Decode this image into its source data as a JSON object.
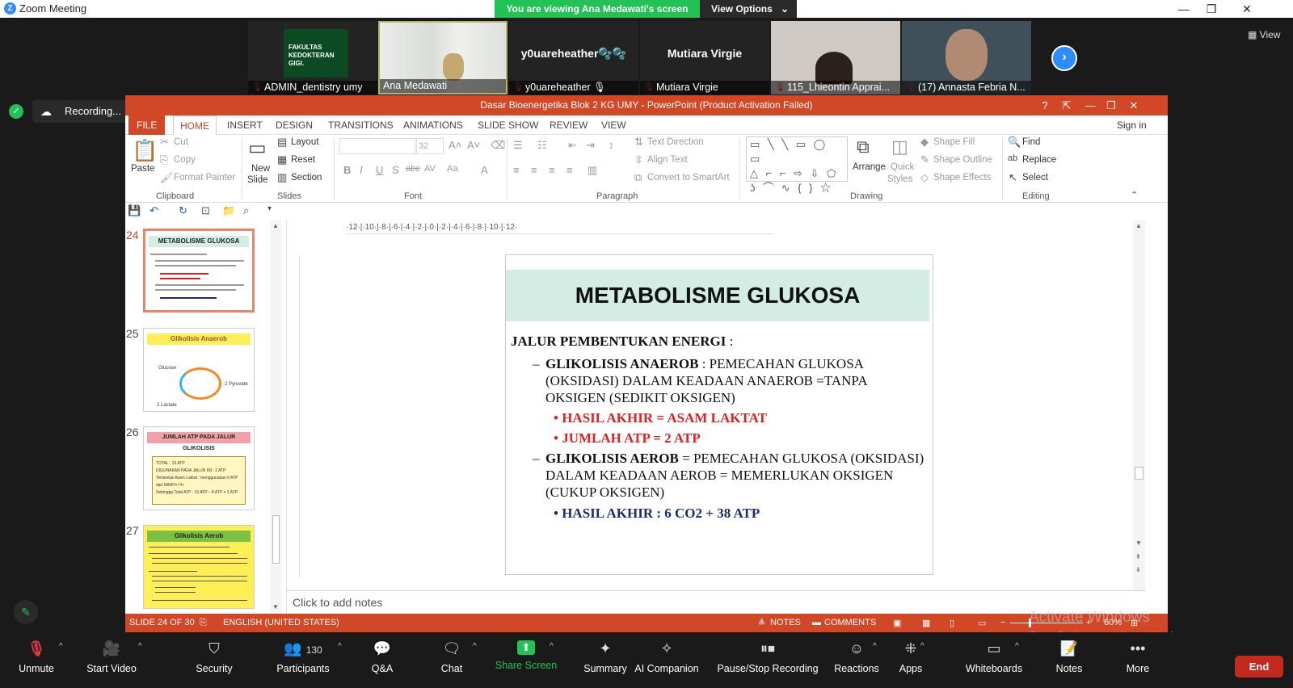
{
  "zoom": {
    "window_title": "Zoom Meeting",
    "viewing_banner": "You are viewing Ana Medawati's screen",
    "view_options": "View Options",
    "view_button": "View",
    "recording_label": "Recording...",
    "participants_strip": [
      {
        "name": "ADMIN_dentistry umy",
        "logo_text": "FAKULTAS KEDOKTERAN GIGI."
      },
      {
        "name": "Ana Medawati"
      },
      {
        "name": "y0uareheather 🎙",
        "display": "y0uareheather🫧🫧"
      },
      {
        "name": "Mutiara Virgie",
        "display": "Mutiara Virgie"
      },
      {
        "name": "115_Lhieontin Apprai..."
      },
      {
        "name": "(17) Annasta Febria N..."
      }
    ],
    "toolbar": {
      "unmute": "Unmute",
      "start_video": "Start Video",
      "security": "Security",
      "participants": "Participants",
      "participants_count": "130",
      "qa": "Q&A",
      "chat": "Chat",
      "share_screen": "Share Screen",
      "summary": "Summary",
      "ai_companion": "AI Companion",
      "pause_stop_recording": "Pause/Stop Recording",
      "reactions": "Reactions",
      "apps": "Apps",
      "whiteboards": "Whiteboards",
      "notes": "Notes",
      "more": "More",
      "end": "End"
    },
    "watermark_line1": "Activate Windows",
    "watermark_line2": "Go to Settings to activate Windows."
  },
  "ppt": {
    "title": "Dasar Bioenergetika Blok 2 KG UMY -  PowerPoint (Product Activation Failed)",
    "help": "?",
    "sign_in": "Sign in",
    "tabs": [
      "FILE",
      "HOME",
      "INSERT",
      "DESIGN",
      "TRANSITIONS",
      "ANIMATIONS",
      "SLIDE SHOW",
      "REVIEW",
      "VIEW"
    ],
    "clipboard": {
      "paste": "Paste",
      "cut": "Cut",
      "copy": "Copy",
      "format_painter": "Format Painter",
      "group": "Clipboard"
    },
    "slides": {
      "new_slide": "New",
      "new_slide2": "Slide",
      "layout": "Layout",
      "reset": "Reset",
      "section": "Section",
      "group": "Slides"
    },
    "font": {
      "size": "32",
      "group": "Font"
    },
    "paragraph": {
      "text_direction": "Text Direction",
      "align_text": "Align Text",
      "convert_smartart": "Convert to SmartArt",
      "group": "Paragraph"
    },
    "drawing": {
      "arrange": "Arrange",
      "quick_styles": "Quick",
      "quick_styles2": "Styles",
      "shape_fill": "Shape Fill",
      "shape_outline": "Shape Outline",
      "shape_effects": "Shape Effects",
      "group": "Drawing"
    },
    "editing": {
      "find": "Find",
      "replace": "Replace",
      "select": "Select",
      "group": "Editing"
    },
    "slide_thumbs": [
      {
        "num": "24",
        "title": "METABOLISME GLUKOSA"
      },
      {
        "num": "25",
        "title": "Glikolisis Anaerob",
        "labels": [
          "Glucose",
          "2 Pyruvate",
          "2 Lactate"
        ]
      },
      {
        "num": "26",
        "title": "JUMLAH ATP PADA JALUR GLIKOLISIS",
        "lines": [
          "TOTAL : 10 ATP",
          "DIGUNAKAN PADA JALUR INI : 2 ATP",
          "Terbentuk Asam Laktat : menggunakan 6 ATP dari NADH+ H+",
          "Sehingga Total ATP : 10 ATP – 8 ATP = 2 ATP"
        ]
      },
      {
        "num": "27",
        "title": "Glikolisis Aerob"
      }
    ],
    "ruler_marks": "·12·|·10·|·8·|·6·|·4·|·2·|·0·|·2·|·4·|·6·|·8·|·10·|·12·",
    "slide": {
      "title": "METABOLISME GLUKOSA",
      "heading": "JALUR PEMBENTUKAN ENERGI",
      "heading_suffix": " :",
      "anaerob_label": "GLIKOLISIS ANAEROB",
      "anaerob_text": " : PEMECAHAN GLUKOSA (OKSIDASI) DALAM KEADAAN ANAEROB =TANPA OKSIGEN (SEDIKIT OKSIGEN)",
      "anaerob_result": "HASIL AKHIR = ASAM LAKTAT",
      "anaerob_atp": "JUMLAH ATP = 2 ATP",
      "aerob_label": "GLIKOLISIS AEROB",
      "aerob_text": " = PEMECAHAN GLUKOSA (OKSIDASI) DALAM KEADAAN AEROB = MEMERLUKAN OKSIGEN (CUKUP  OKSIGEN)",
      "aerob_result": "HASIL AKHIR : 6 CO2 + 38 ATP"
    },
    "notes_placeholder": "Click to add notes",
    "status": {
      "slide": "SLIDE 24 OF 30",
      "language": "ENGLISH (UNITED STATES)",
      "notes": "NOTES",
      "comments": "COMMENTS",
      "zoom": "60%"
    }
  },
  "colors": {
    "ppt_accent": "#d24726",
    "zoom_green": "#23c257",
    "zoom_blue": "#2d8cff",
    "slide_title_bg": "#d3ede4",
    "red_text": "#e02020",
    "navy_text": "#1a2d6b"
  }
}
